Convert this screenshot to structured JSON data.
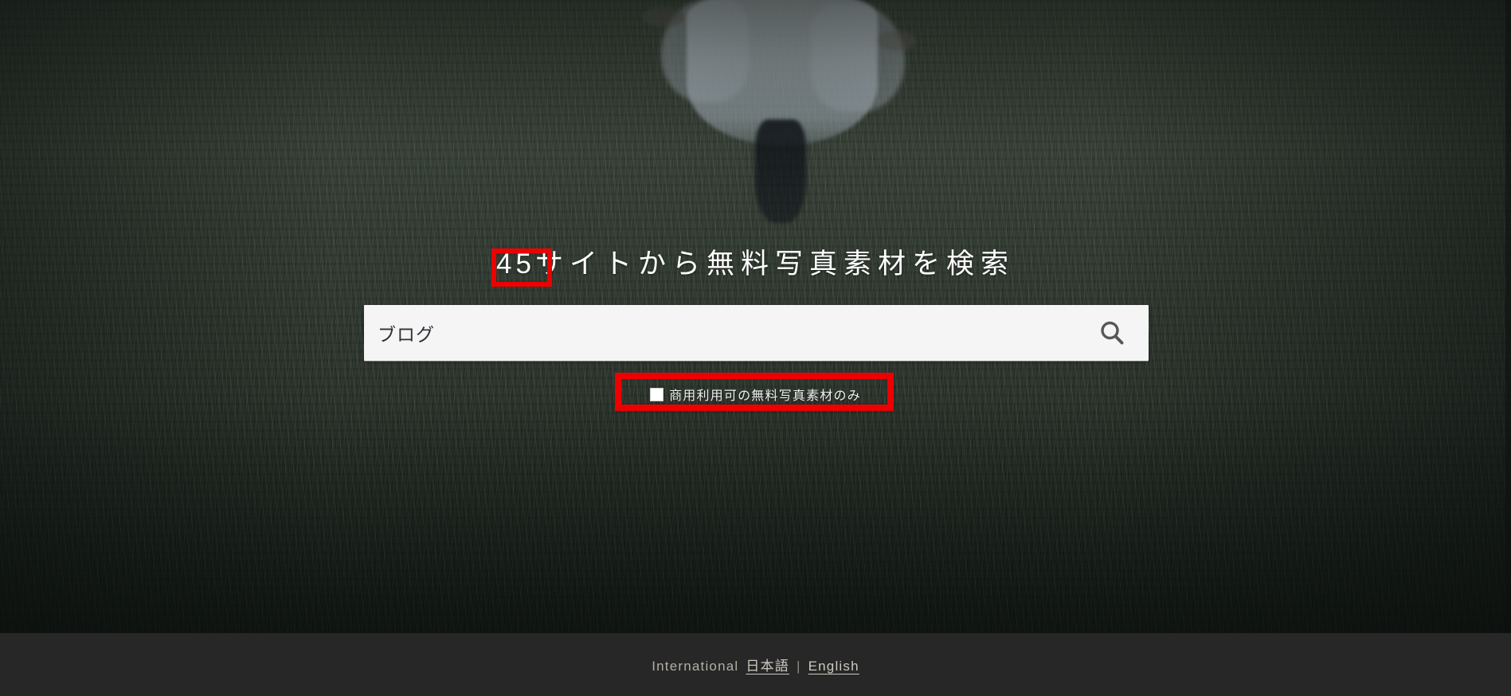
{
  "hero": {
    "headline_prefix_count": "45",
    "headline_rest": "サイトから無料写真素材を検索",
    "background_alt": "woman-walking-in-wheat-field"
  },
  "search": {
    "value": "ブログ",
    "placeholder": "ブログ",
    "button_icon": "search-icon"
  },
  "filter": {
    "label": "商用利用可の無料写真素材のみ",
    "checked": false
  },
  "annotations": [
    {
      "name": "headline-count-highlight",
      "color": "#ec0000",
      "target": "45"
    },
    {
      "name": "commercial-filter-highlight",
      "color": "#ec0000",
      "target": "商用利用可の無料写真素材のみ"
    }
  ],
  "footer": {
    "label": "International",
    "links": [
      {
        "label": "日本語"
      },
      {
        "label": "English"
      }
    ],
    "separator": "|"
  },
  "colors": {
    "accent_annotation": "#ec0000",
    "footer_background": "#272727",
    "footer_text": "#b2aea7",
    "search_background": "#f5f5f5",
    "headline_text": "#ffffff"
  }
}
